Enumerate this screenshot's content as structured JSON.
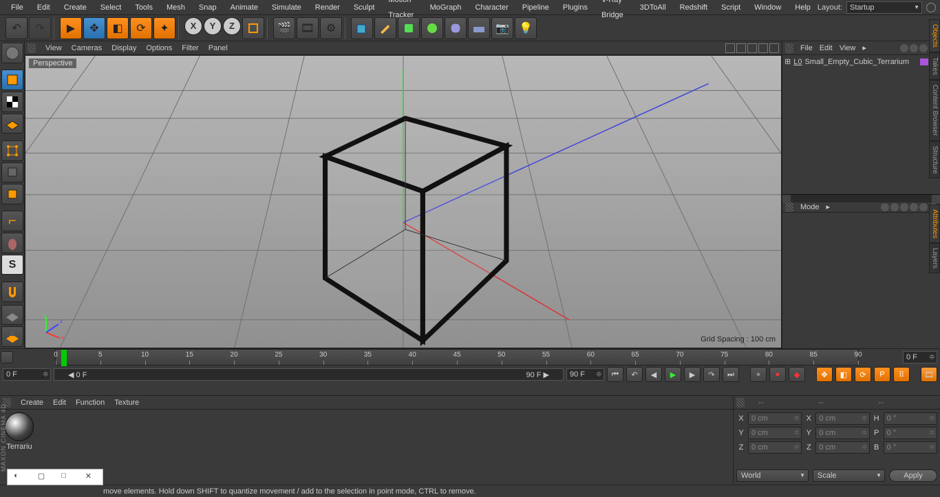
{
  "menubar": [
    "File",
    "Edit",
    "Create",
    "Select",
    "Tools",
    "Mesh",
    "Snap",
    "Animate",
    "Simulate",
    "Render",
    "Sculpt",
    "Motion Tracker",
    "MoGraph",
    "Character",
    "Pipeline",
    "Plugins",
    "V-Ray Bridge",
    "3DToAll",
    "Redshift",
    "Script",
    "Window",
    "Help"
  ],
  "layout": {
    "label": "Layout:",
    "value": "Startup"
  },
  "viewport_menu": [
    "View",
    "Cameras",
    "Display",
    "Options",
    "Filter",
    "Panel"
  ],
  "viewport": {
    "label": "Perspective",
    "grid_spacing": "Grid Spacing : 100 cm"
  },
  "right": {
    "tabs": [
      "Objects",
      "Takes",
      "Content Browser",
      "Structure",
      "Attributes",
      "Layers"
    ],
    "obj_menu": [
      "File",
      "Edit",
      "View"
    ],
    "attr_menu": [
      "Mode"
    ],
    "object_name": "Small_Empty_Cubic_Terrarium"
  },
  "timeline": {
    "ticks": [
      0,
      5,
      10,
      15,
      20,
      25,
      30,
      35,
      40,
      45,
      50,
      55,
      60,
      65,
      70,
      75,
      80,
      85,
      90
    ],
    "current": "0 F",
    "range_start": "0 F",
    "range_end": "90 F",
    "end": "90 F",
    "right": "0 F"
  },
  "materials": {
    "menu": [
      "Create",
      "Edit",
      "Function",
      "Texture"
    ],
    "items": [
      "Terrariu"
    ]
  },
  "coords": {
    "hdr": [
      "--",
      "--",
      "--"
    ],
    "rows": [
      {
        "a": "X",
        "av": "0 cm",
        "b": "X",
        "bv": "0 cm",
        "c": "H",
        "cv": "0 °"
      },
      {
        "a": "Y",
        "av": "0 cm",
        "b": "Y",
        "bv": "0 cm",
        "c": "P",
        "cv": "0 °"
      },
      {
        "a": "Z",
        "av": "0 cm",
        "b": "Z",
        "bv": "0 cm",
        "c": "B",
        "cv": "0 °"
      }
    ],
    "dd1": "World",
    "dd2": "Scale",
    "apply": "Apply"
  },
  "status": "move elements. Hold down SHIFT to quantize movement / add to the selection in point mode, CTRL to remove.",
  "brand": "MAXON CINEMA 4D"
}
